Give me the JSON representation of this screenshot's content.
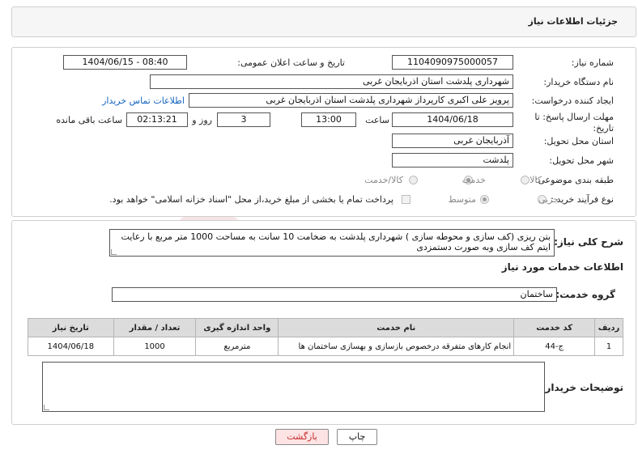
{
  "header": {
    "title": "جزئیات اطلاعات نیاز"
  },
  "info": {
    "need_number_label": "شماره نیاز:",
    "need_number": "1104090975000057",
    "announce_label": "تاریخ و ساعت اعلان عمومی:",
    "announce_value": "1404/06/15 - 08:40",
    "buyer_org_label": "نام دستگاه خریدار:",
    "buyer_org": "شهرداری پلدشت استان اذربایجان غربی",
    "requester_label": "ایجاد کننده درخواست:",
    "requester": "پرویز علی اکبری کارپرداز شهرداری پلدشت استان اذربایجان غربی",
    "contact_link": "اطلاعات تماس خریدار",
    "deadline_label_line1": "مهلت ارسال پاسخ: تا",
    "deadline_label_line2": "تاریخ:",
    "deadline_date": "1404/06/18",
    "time_label": "ساعت",
    "deadline_time": "13:00",
    "days_value": "3",
    "days_label": "روز و",
    "remaining_time": "02:13:21",
    "remaining_label": "ساعت باقی مانده",
    "province_label": "استان محل تحویل:",
    "province": "آذربایجان غربی",
    "city_label": "شهر محل تحویل:",
    "city": "پلدشت",
    "category_label": "طبقه بندی موضوعی:",
    "category_options": [
      "کالا",
      "خدمت",
      "کالا/خدمت"
    ],
    "process_label": "نوع فرآیند خرید :",
    "process_options": [
      "جزیی",
      "متوسط"
    ],
    "payment_note": "پرداخت تمام یا بخشی از مبلغ خرید،از محل \"اسناد خزانه اسلامی\" خواهد بود."
  },
  "description": {
    "label": "شرح کلی نیاز:",
    "text": "بتن ریزی (کف سازی  و محوطه سازی )  شهرداری  پلدشت به ضخامت 10 سانت به مساحت 1000 متر مربع با رعایت ایتم کف سازی وبه صورت دستمزدی"
  },
  "services": {
    "section_title": "اطلاعات خدمات مورد نیاز",
    "group_label": "گروه خدمت:",
    "group_value": "ساختمان",
    "columns": [
      "ردیف",
      "کد خدمت",
      "نام خدمت",
      "واحد اندازه گیری",
      "تعداد / مقدار",
      "تاریخ نیاز"
    ],
    "rows": [
      [
        "1",
        "ج-44",
        "انجام کارهای متفرقه درخصوص بازسازی و بهسازی ساختمان ها",
        "مترمربع",
        "1000",
        "1404/06/18"
      ]
    ]
  },
  "buyer_notes": {
    "label": "توضیحات خریدار:",
    "value": ""
  },
  "buttons": {
    "print": "چاپ",
    "back": "بازگشت"
  },
  "watermark": {
    "text": "AriaTender.neT"
  },
  "colors": {
    "link": "#1565c0",
    "back_button_bg": "#fde3e3",
    "back_button_text": "#c62828"
  }
}
